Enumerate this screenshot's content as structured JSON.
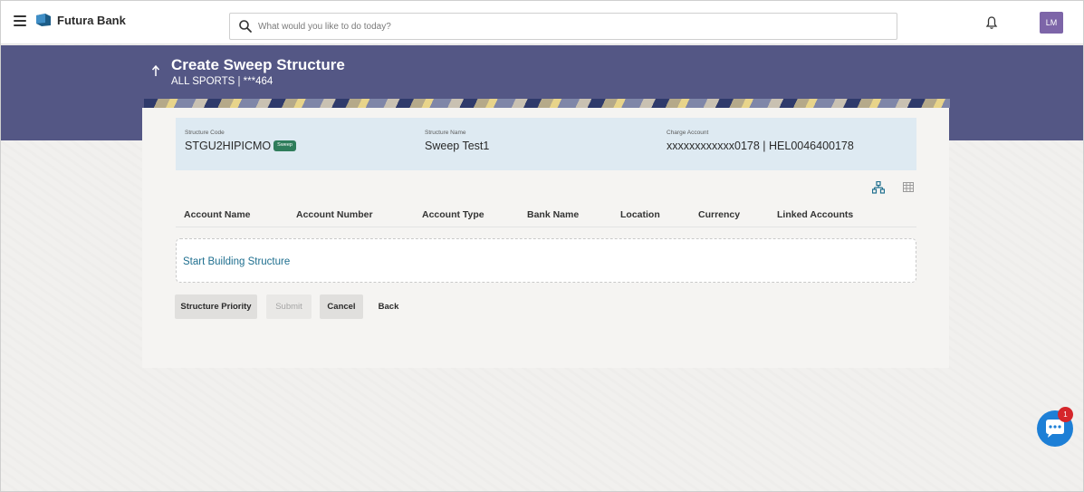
{
  "topbar": {
    "brand": "Futura Bank",
    "search_placeholder": "What would you like to do today?",
    "avatar_initials": "LM"
  },
  "header": {
    "title": "Create Sweep Structure",
    "subtitle": "ALL SPORTS | ***464"
  },
  "structure": {
    "code_label": "Structure Code",
    "code_value": "STGU2HIPICMO",
    "badge": "Sweep",
    "name_label": "Structure Name",
    "name_value": "Sweep Test1",
    "charge_label": "Charge Account",
    "charge_value": "xxxxxxxxxxxx0178 | HEL0046400178"
  },
  "table": {
    "columns": [
      "Account Name",
      "Account Number",
      "Account Type",
      "Bank Name",
      "Location",
      "Currency",
      "Linked Accounts"
    ]
  },
  "builder": {
    "start_link": "Start Building Structure"
  },
  "actions": {
    "priority": "Structure Priority",
    "submit": "Submit",
    "cancel": "Cancel",
    "back": "Back"
  },
  "chat": {
    "badge_count": "1"
  },
  "colors": {
    "band": "#545785",
    "info_panel": "#deeaf2",
    "link": "#1f6f8f",
    "sweep_badge": "#2f7d5b",
    "avatar": "#7d65a8",
    "chat": "#1d7fd6"
  }
}
